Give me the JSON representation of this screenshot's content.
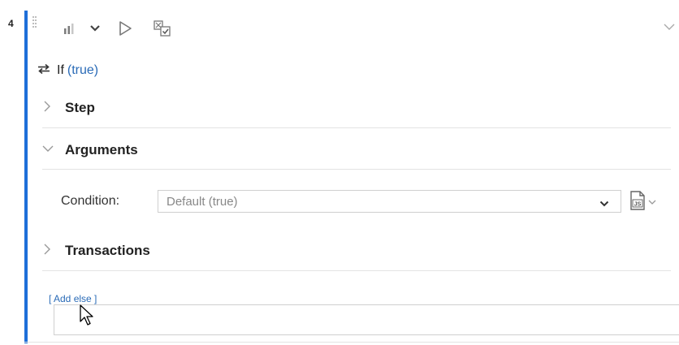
{
  "step": {
    "number": "4",
    "keyword": "If",
    "condition_display": "(true)"
  },
  "toolbar": {
    "icons": [
      "bar-chart-icon",
      "chevron-down-icon",
      "play-icon",
      "checkbox-toggle-icon"
    ]
  },
  "sections": {
    "step_label": "Step",
    "arguments_label": "Arguments",
    "transactions_label": "Transactions"
  },
  "arguments": {
    "condition_label": "Condition:",
    "condition_value": "Default (true)"
  },
  "add_else_label": "[ Add else ]",
  "colors": {
    "accent": "#1e6fd9",
    "link": "#2a6bb7"
  }
}
